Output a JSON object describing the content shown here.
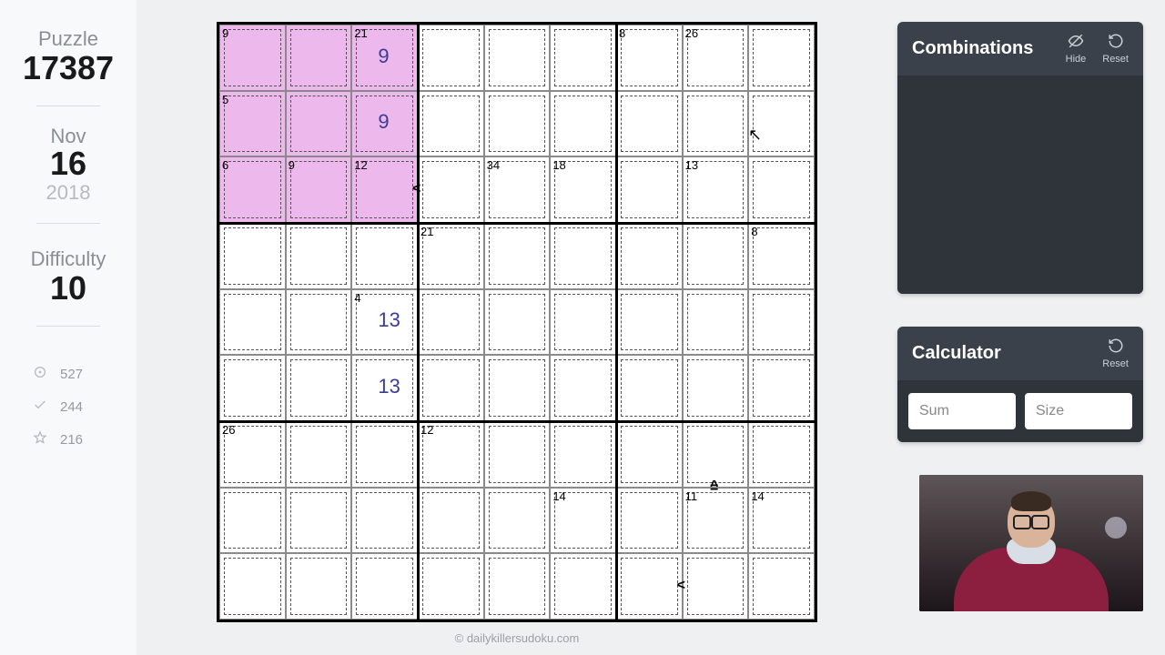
{
  "sidebar": {
    "puzzle_label": "Puzzle",
    "puzzle_number": "17387",
    "date_month": "Nov",
    "date_day": "16",
    "date_year": "2018",
    "difficulty_label": "Difficulty",
    "difficulty_value": "10",
    "stats": {
      "views": "527",
      "solved": "244",
      "rated": "216"
    }
  },
  "board": {
    "size": 9,
    "highlight_box": [
      0,
      0,
      3,
      3
    ],
    "cages": [
      {
        "r": 0,
        "c": 0,
        "sum": "9"
      },
      {
        "r": 0,
        "c": 2,
        "sum": "21"
      },
      {
        "r": 0,
        "c": 6,
        "sum": "8"
      },
      {
        "r": 0,
        "c": 7,
        "sum": "26"
      },
      {
        "r": 1,
        "c": 0,
        "sum": "5"
      },
      {
        "r": 2,
        "c": 0,
        "sum": "6"
      },
      {
        "r": 2,
        "c": 1,
        "sum": "9"
      },
      {
        "r": 2,
        "c": 2,
        "sum": "12"
      },
      {
        "r": 2,
        "c": 4,
        "sum": "34"
      },
      {
        "r": 2,
        "c": 5,
        "sum": "18"
      },
      {
        "r": 2,
        "c": 7,
        "sum": "13"
      },
      {
        "r": 3,
        "c": 3,
        "sum": "21"
      },
      {
        "r": 3,
        "c": 8,
        "sum": "8"
      },
      {
        "r": 4,
        "c": 2,
        "sum": "4"
      },
      {
        "r": 6,
        "c": 0,
        "sum": "26"
      },
      {
        "r": 6,
        "c": 3,
        "sum": "12"
      },
      {
        "r": 7,
        "c": 5,
        "sum": "14"
      },
      {
        "r": 7,
        "c": 7,
        "sum": "11"
      },
      {
        "r": 7,
        "c": 8,
        "sum": "14"
      }
    ],
    "pencils": [
      {
        "r": 0,
        "c": 2,
        "v": "9"
      },
      {
        "r": 1,
        "c": 2,
        "v": "9"
      },
      {
        "r": 4,
        "c": 2,
        "v": "13"
      },
      {
        "r": 5,
        "c": 2,
        "v": "13"
      }
    ],
    "inequalities": [
      {
        "r": 2,
        "c": 3,
        "side": "left",
        "sym": "<"
      },
      {
        "r": 6,
        "c": 7,
        "side": "bottom",
        "sym": "="
      },
      {
        "r": 7,
        "c": 7,
        "side": "top",
        "sym": "^"
      },
      {
        "r": 8,
        "c": 7,
        "side": "left",
        "sym": "<"
      }
    ]
  },
  "combinations": {
    "title": "Combinations",
    "hide_label": "Hide",
    "reset_label": "Reset"
  },
  "calculator": {
    "title": "Calculator",
    "reset_label": "Reset",
    "sum_placeholder": "Sum",
    "size_placeholder": "Size"
  },
  "footer": {
    "copyright": "© dailykillersudoku.com"
  }
}
